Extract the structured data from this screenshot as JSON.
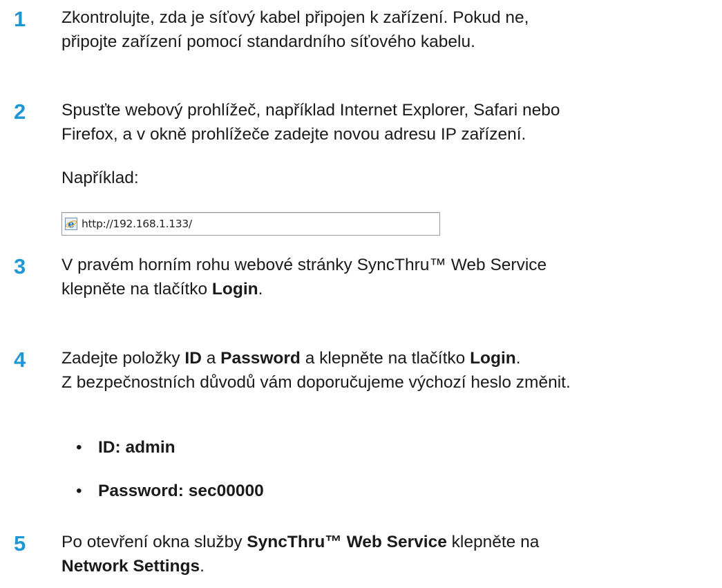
{
  "steps": [
    {
      "number": "1",
      "lines": [
        [
          {
            "t": "Zkontrolujte, zda je síťový kabel připojen k zařízení. Pokud ne,",
            "b": false
          }
        ],
        [
          {
            "t": "připojte zařízení pomocí standardního síťového kabelu.",
            "b": false
          }
        ]
      ]
    },
    {
      "number": "2",
      "lines": [
        [
          {
            "t": "Spusťte webový prohlížeč, například Internet Explorer, Safari nebo",
            "b": false
          }
        ],
        [
          {
            "t": "Firefox, a v okně prohlížeče zadejte novou adresu IP zařízení.",
            "b": false
          }
        ]
      ]
    },
    {
      "number": "3",
      "lines": [
        [
          {
            "t": "V pravém horním rohu webové stránky SyncThru™ Web Service",
            "b": false
          }
        ],
        [
          {
            "t": "klepněte na tlačítko ",
            "b": false
          },
          {
            "t": "Login",
            "b": true
          },
          {
            "t": ".",
            "b": false
          }
        ]
      ]
    },
    {
      "number": "4",
      "lines": [
        [
          {
            "t": "Zadejte položky ",
            "b": false
          },
          {
            "t": "ID",
            "b": true
          },
          {
            "t": " a ",
            "b": false
          },
          {
            "t": "Password",
            "b": true
          },
          {
            "t": " a klepněte na tlačítko ",
            "b": false
          },
          {
            "t": "Login",
            "b": true
          },
          {
            "t": ".",
            "b": false
          }
        ],
        [
          {
            "t": "Z bezpečnostních důvodů vám doporučujeme výchozí heslo změnit.",
            "b": false
          }
        ]
      ]
    },
    {
      "number": "5",
      "lines": [
        [
          {
            "t": "Po otevření okna služby ",
            "b": false
          },
          {
            "t": "SyncThru™ Web Service",
            "b": true
          },
          {
            "t": " klepněte na",
            "b": false
          }
        ],
        [
          {
            "t": "Network Settings",
            "b": true
          },
          {
            "t": ".",
            "b": false
          }
        ]
      ]
    }
  ],
  "example": {
    "label": "Například:",
    "address_bar": {
      "icon": "internet-explorer-icon",
      "url": "http://192.168.1.133/"
    }
  },
  "credentials": [
    {
      "bullet": "•",
      "text": "ID: admin"
    },
    {
      "bullet": "•",
      "text": "Password: sec00000"
    }
  ],
  "colors": {
    "step_number": "#1f97d4",
    "text": "#1a1a1a"
  }
}
